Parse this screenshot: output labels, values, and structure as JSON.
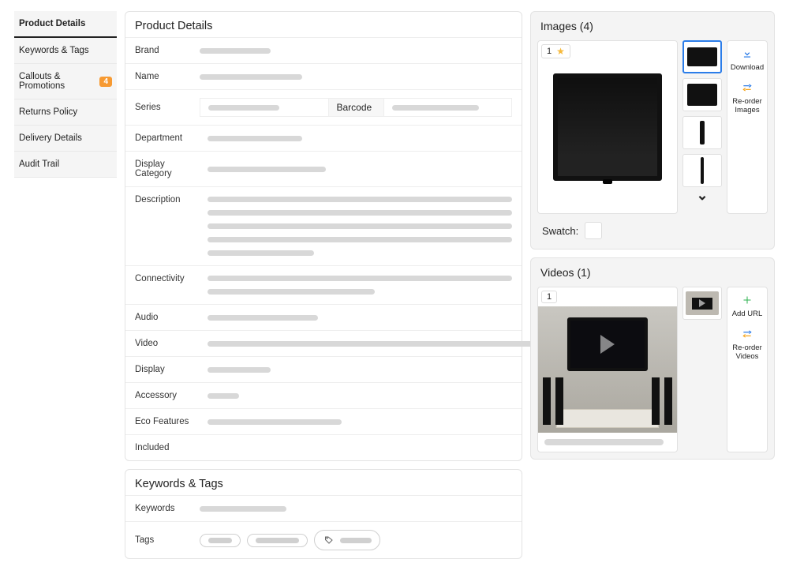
{
  "sidebar": {
    "items": [
      {
        "label": "Product Details"
      },
      {
        "label": "Keywords & Tags"
      },
      {
        "label": "Callouts & Promotions",
        "badge": "4"
      },
      {
        "label": "Returns Policy"
      },
      {
        "label": "Delivery Details"
      },
      {
        "label": "Audit Trail"
      }
    ]
  },
  "product_details": {
    "title": "Product Details",
    "fields": {
      "brand": "Brand",
      "name": "Name",
      "series": "Series",
      "barcode": "Barcode",
      "department": "Department",
      "display_category": "Display Category",
      "description": "Description",
      "connectivity": "Connectivity",
      "audio": "Audio",
      "video": "Video",
      "display": "Display",
      "accessory": "Accessory",
      "eco": "Eco Features",
      "included": "Included"
    }
  },
  "keywords": {
    "title": "Keywords & Tags",
    "fields": {
      "keywords": "Keywords",
      "tags": "Tags"
    }
  },
  "images": {
    "title": "Images (4)",
    "count": 4,
    "selected": "1",
    "swatch_label": "Swatch:",
    "actions": {
      "download": "Download",
      "reorder": "Re-order Images"
    }
  },
  "videos": {
    "title": "Videos (1)",
    "count": 1,
    "selected": "1",
    "actions": {
      "add": "Add URL",
      "reorder": "Re-order Videos"
    }
  }
}
